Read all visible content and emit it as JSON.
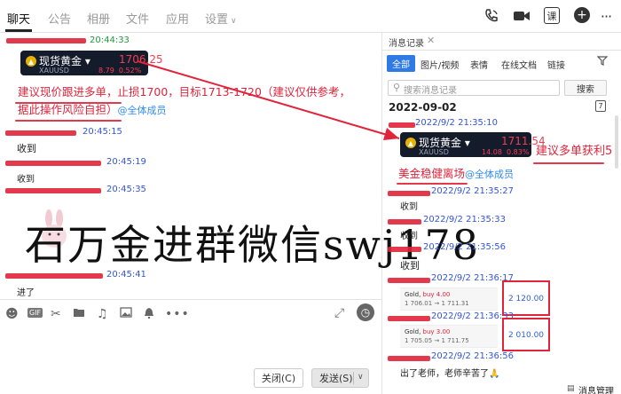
{
  "top_nav": {
    "tabs": [
      "聊天",
      "公告",
      "相册",
      "文件",
      "应用",
      "设置"
    ],
    "active_tab": "聊天",
    "icons": [
      "phone-icon",
      "video-icon",
      "class-icon",
      "plus-icon",
      "more-icon"
    ],
    "class_label": "课"
  },
  "chat": {
    "messages": [
      {
        "time": "20:44:33",
        "card": {
          "name": "现货黄金",
          "symbol": "XAUUSD",
          "price": "1706.25",
          "change": "8.79",
          "change_pct": "0.52%"
        }
      },
      {
        "text_line1": "建议现价跟进多单，止损1700，目标1713-1720（建议仅供参考，",
        "text_line2": "据此操作风险自担）",
        "mention": "@全体成员"
      },
      {
        "time": "20:45:15",
        "text": "收到"
      },
      {
        "time": "20:45:19",
        "text": "收到"
      },
      {
        "time": "20:45:35"
      },
      {
        "time": "20:45:41",
        "text": "进了"
      }
    ],
    "watermark": "石万金进群微信swj178"
  },
  "input_bar": {
    "close_label": "关闭(C)",
    "send_label": "发送(S)",
    "gif_label": "GIF"
  },
  "history": {
    "title": "消息记录",
    "tabs": [
      "全部",
      "图片/视频",
      "表情",
      "在线文档",
      "链接"
    ],
    "search_placeholder": "搜索消息记录",
    "search_button": "搜索",
    "date": "2022-09-02",
    "calendar_day": "7",
    "items": [
      {
        "time": "2022/9/2 21:35:10",
        "card": {
          "name": "现货黄金",
          "symbol": "XAUUSD",
          "price": "1711.54",
          "change": "14.08",
          "change_pct": "0.83%"
        },
        "annotation": "建议多单获利5"
      },
      {
        "text": "美金稳健离场",
        "mention": "@全体成员"
      },
      {
        "time": "2022/9/2 21:35:27",
        "text": "收到"
      },
      {
        "time": "2022/9/2 21:35:33",
        "text": "收到"
      },
      {
        "time": "2022/9/2 21:35:56",
        "text": "收到"
      },
      {
        "time": "2022/9/2 21:36:17",
        "trade": {
          "line1_a": "Gold, ",
          "line1_b": "buy 4.00",
          "line2": "1 706.01 → 1 711.31"
        },
        "profit": "2 120.00"
      },
      {
        "time": "2022/9/2 21:36:33",
        "trade": {
          "line1_a": "Gold, ",
          "line1_b": "buy 3.00",
          "line2": "1 705.05 → 1 711.75"
        },
        "profit": "2 010.00"
      },
      {
        "time": "2022/9/2 21:36:56",
        "text": "出了老师，老师辛苦了🙏"
      }
    ],
    "footer_label": "消息管理"
  },
  "colors": {
    "accent_red": "#e0243a",
    "link_blue": "#2f8cf2",
    "card_bg": "#141b2b",
    "active_tab_blue": "#2f7be3"
  }
}
